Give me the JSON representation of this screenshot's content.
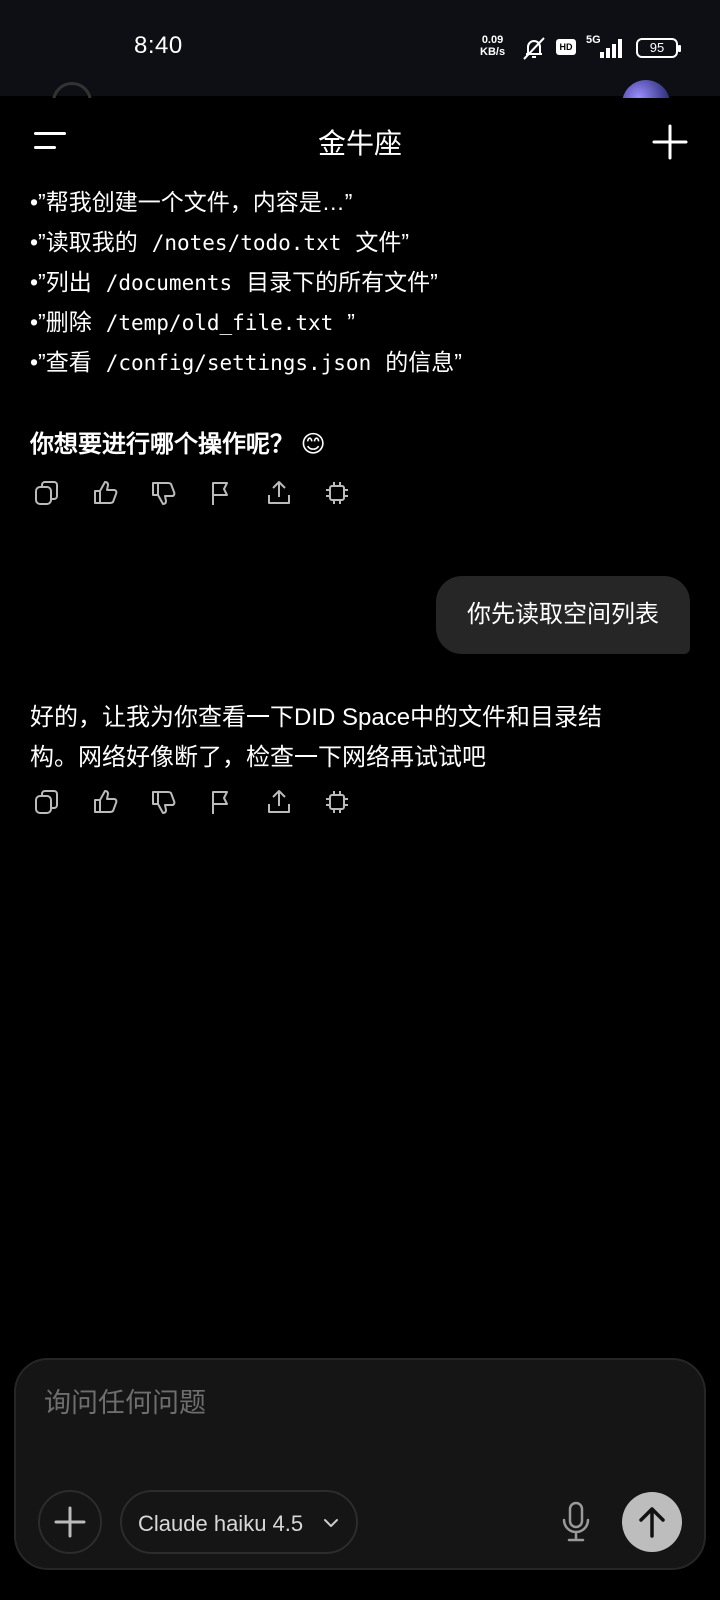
{
  "status_bar": {
    "time": "8:40",
    "net_speed_value": "0.09",
    "net_speed_unit": "KB/s",
    "hd_badge": "HD",
    "network": "5G",
    "battery": "95",
    "icons": [
      "mute-bell-icon",
      "hd-icon",
      "signal-icon",
      "battery-icon"
    ]
  },
  "header": {
    "title": "金牛座",
    "menu_icon": "menu-icon",
    "add_icon": "plus-icon"
  },
  "messages": {
    "examples": [
      {
        "prefix": "•”帮我创建一个文件，内容是…”",
        "code": "",
        "suffix": ""
      },
      {
        "prefix": "•”读取我的",
        "code": "/notes/todo.txt",
        "suffix": "文件”"
      },
      {
        "prefix": "•”列出",
        "code": "/documents",
        "suffix": "目录下的所有文件”"
      },
      {
        "prefix": "•”删除",
        "code": "/temp/old_file.txt",
        "suffix": "”"
      },
      {
        "prefix": "•”查看",
        "code": "/config/settings.json",
        "suffix": "的信息”"
      }
    ],
    "question": "你想要进行哪个操作呢？ 😊",
    "user_message": "你先读取空间列表",
    "reply_line1": "好的，让我为你查看一下DID Space中的文件和目录结",
    "reply_line2": "构。网络好像断了，检查一下网络再试试吧",
    "action_icons": [
      "copy-icon",
      "thumbs-up-icon",
      "thumbs-down-icon",
      "flag-icon",
      "share-icon",
      "chip-icon"
    ]
  },
  "composer": {
    "placeholder": "询问任何问题",
    "model": "Claude haiku 4.5"
  },
  "colors": {
    "background": "#000000",
    "bubble": "#262626",
    "composer": "#151515",
    "send_button": "#bdbdbd"
  }
}
